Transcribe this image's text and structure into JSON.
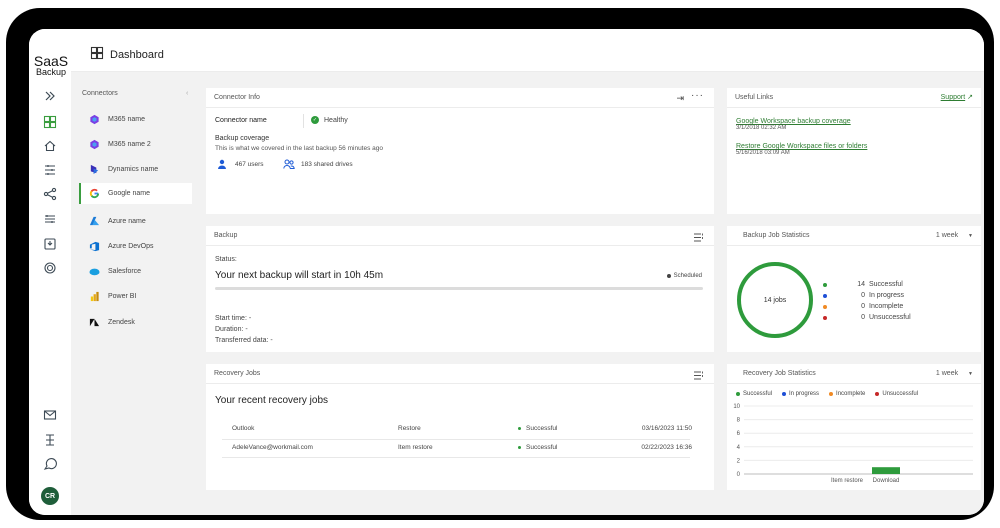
{
  "brand": {
    "line1": "SaaS",
    "line2": "Backup"
  },
  "header": {
    "title": "Dashboard"
  },
  "connectors": {
    "heading": "Connectors",
    "items": [
      {
        "label": "M365 name",
        "icon": "m365-icon"
      },
      {
        "label": "M365 name 2",
        "icon": "m365-icon"
      },
      {
        "label": "Dynamics name",
        "icon": "dynamics-icon"
      },
      {
        "label": "Google name",
        "icon": "google-icon",
        "active": true
      },
      {
        "label": "Azure name",
        "icon": "azure-icon"
      },
      {
        "label": "Azure DevOps",
        "icon": "azure-devops-icon"
      },
      {
        "label": "Salesforce",
        "icon": "salesforce-icon"
      },
      {
        "label": "Power BI",
        "icon": "powerbi-icon"
      },
      {
        "label": "Zendesk",
        "icon": "zendesk-icon"
      }
    ]
  },
  "connector_info": {
    "title": "Connector Info",
    "name_label": "Connector name",
    "status": "Healthy",
    "coverage_title": "Backup coverage",
    "coverage_desc": "This is what we covered in the last backup 56 minutes ago",
    "users": "467 users",
    "drives": "183 shared drives"
  },
  "useful_links": {
    "title": "Useful Links",
    "support": "Support",
    "links": [
      {
        "label": "Google Workspace backup coverage",
        "date": "3/1/2018 02:32 AM"
      },
      {
        "label": "Restore Google Workspace files or folders",
        "date": "5/16/2018 03:09 AM"
      }
    ]
  },
  "backup": {
    "title": "Backup",
    "status_label": "Status:",
    "next_backup": "Your next backup will start in 10h 45m",
    "scheduled": "Scheduled",
    "start_time": "Start time: -",
    "duration": "Duration: -",
    "transferred": "Transferred data: -"
  },
  "backup_stats": {
    "title": "Backup Job Statistics",
    "period": "1 week",
    "center": "14 jobs",
    "legend": [
      {
        "count": "14",
        "label": "Successful",
        "color": "#2e9b3c"
      },
      {
        "count": "0",
        "label": "In progress",
        "color": "#1e4fd6"
      },
      {
        "count": "0",
        "label": "Incomplete",
        "color": "#f08a24"
      },
      {
        "count": "0",
        "label": "Unsuccessful",
        "color": "#c62828"
      }
    ]
  },
  "recovery_jobs": {
    "title": "Recovery Jobs",
    "heading": "Your recent recovery jobs",
    "rows": [
      {
        "source": "Outlook",
        "type": "Restore",
        "status": "Successful",
        "date": "03/16/2023 11:50"
      },
      {
        "source": "AdeleVance@workmail.com",
        "type": "Item restore",
        "status": "Successful",
        "date": "02/22/2023 16:36"
      }
    ]
  },
  "recovery_stats": {
    "title": "Recovery Job Statistics",
    "period": "1 week",
    "legend": [
      {
        "label": "Successful",
        "color": "#2e9b3c"
      },
      {
        "label": "In progress",
        "color": "#1e4fd6"
      },
      {
        "label": "Incomplete",
        "color": "#f08a24"
      },
      {
        "label": "Unsuccessful",
        "color": "#c62828"
      }
    ]
  },
  "user": {
    "initials": "CR"
  },
  "chart_data": {
    "type": "bar",
    "categories": [
      "Item restore",
      "Download"
    ],
    "series": [
      {
        "name": "Successful",
        "values": [
          0,
          1
        ]
      }
    ],
    "yticks": [
      "10",
      "8",
      "6",
      "4",
      "2",
      "0"
    ],
    "ylim": [
      0,
      10
    ],
    "grid": true,
    "legend": "top"
  }
}
